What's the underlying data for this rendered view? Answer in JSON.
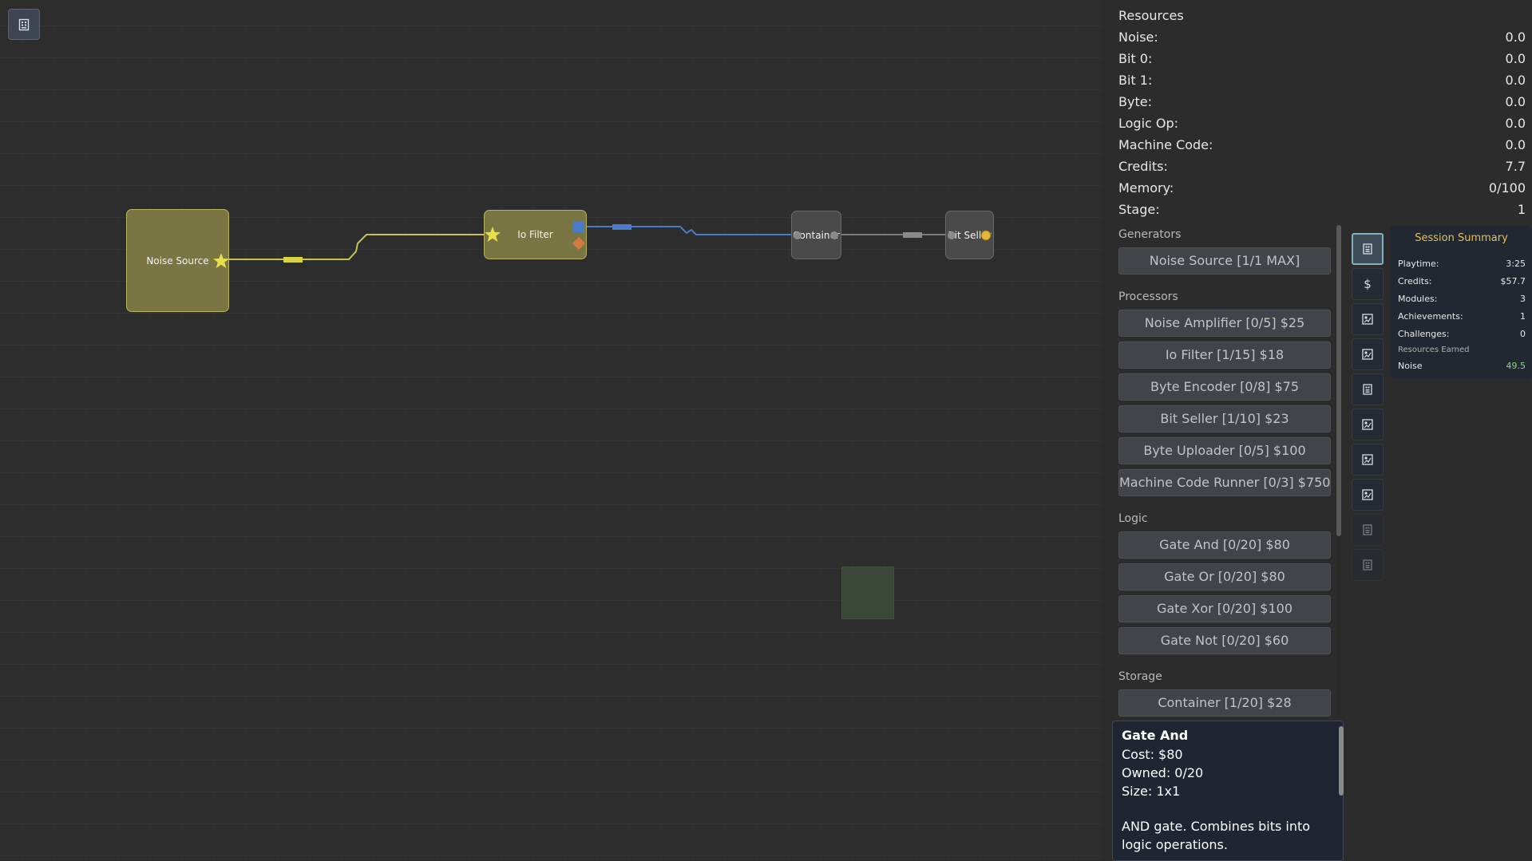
{
  "board": {
    "modules": [
      {
        "id": "noise-source",
        "label": "Noise Source"
      },
      {
        "id": "io-filter",
        "label": "Io Filter"
      },
      {
        "id": "container",
        "label": "Container"
      },
      {
        "id": "bit-seller",
        "label": "Bit Seller"
      }
    ],
    "colors": {
      "gold": "#7a7644",
      "wire_yellow": "#c8c24e",
      "wire_blue": "#4a7bc8",
      "wire_grey": "#7a7a7a"
    }
  },
  "resources": {
    "title": "Resources",
    "rows": [
      {
        "label": "Noise:",
        "value": "0.0"
      },
      {
        "label": "Bit 0:",
        "value": "0.0"
      },
      {
        "label": "Bit 1:",
        "value": "0.0"
      },
      {
        "label": "Byte:",
        "value": "0.0"
      },
      {
        "label": "Logic Op:",
        "value": "0.0"
      },
      {
        "label": "Machine Code:",
        "value": "0.0"
      },
      {
        "label": "Credits:",
        "value": "7.7"
      },
      {
        "label": "Memory:",
        "value": "0/100"
      },
      {
        "label": "Stage:",
        "value": "1"
      }
    ]
  },
  "shop": {
    "generators": {
      "title": "Generators",
      "items": [
        "Noise Source [1/1 MAX]"
      ]
    },
    "processors": {
      "title": "Processors",
      "items": [
        "Noise Amplifier [0/5] $25",
        "Io Filter [1/15] $18",
        "Byte Encoder [0/8] $75",
        "Bit Seller [1/10] $23",
        "Byte Uploader [0/5] $100",
        "Machine Code Runner [0/3] $750"
      ]
    },
    "logic": {
      "title": "Logic",
      "items": [
        "Gate And [0/20] $80",
        "Gate Or [0/20] $80",
        "Gate Xor [0/20] $100",
        "Gate Not [0/20] $60"
      ]
    },
    "storage": {
      "title": "Storage",
      "items": [
        "Container [1/20] $28"
      ]
    }
  },
  "tooltip": {
    "title": "Gate And",
    "cost": "Cost: $80",
    "owned": "Owned: 0/20",
    "size": "Size: 1x1",
    "description": "AND gate. Combines bits into logic operations."
  },
  "tabs": {
    "icons": [
      "chip-icon",
      "dollar-icon",
      "chart-icon",
      "chart-icon",
      "chip-icon",
      "chart-icon",
      "chart-icon",
      "chart-icon",
      "chip-icon",
      "chip-icon"
    ],
    "dollar_glyph": "$"
  },
  "summary": {
    "title": "Session Summary",
    "rows": [
      {
        "label": "Playtime:",
        "value": "3:25"
      },
      {
        "label": "Credits:",
        "value": "$57.7"
      },
      {
        "label": "Modules:",
        "value": "3"
      },
      {
        "label": "Achievements:",
        "value": "1"
      },
      {
        "label": "Challenges:",
        "value": "0"
      }
    ],
    "earned_title": "Resources Earned",
    "earned": [
      {
        "label": "Noise",
        "value": "49.5"
      }
    ]
  }
}
